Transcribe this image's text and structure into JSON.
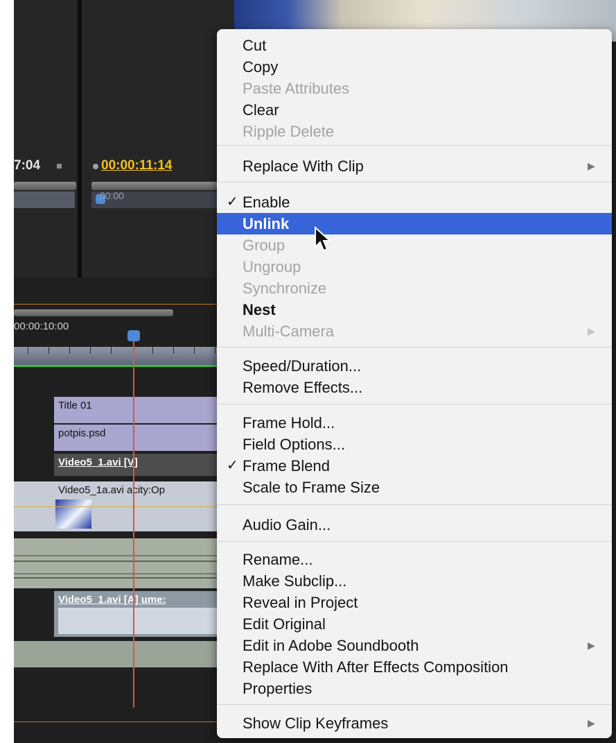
{
  "editor": {
    "timecode_left": "7:04",
    "timecode_current": "00:00:11:14",
    "mini_timecode": ":00:00",
    "ruler_timecode": "00:00:10:00",
    "clips": {
      "title": "Title 01",
      "graphic": "potpis.psd",
      "video": "Video5_1.avi [V]",
      "video_opacity": "Video5_1a.avi acity:Op",
      "audio": "Video5_1.avi [A] ume:"
    }
  },
  "menu": {
    "items": [
      {
        "label": "Cut"
      },
      {
        "label": "Copy"
      },
      {
        "label": "Paste Attributes"
      },
      {
        "label": "Clear"
      },
      {
        "label": "Ripple Delete"
      },
      {
        "label": "Replace With Clip"
      },
      {
        "label": "Enable",
        "check": "✓"
      },
      {
        "label": "Unlink"
      },
      {
        "label": "Group"
      },
      {
        "label": "Ungroup"
      },
      {
        "label": "Synchronize"
      },
      {
        "label": "Nest"
      },
      {
        "label": "Multi-Camera"
      },
      {
        "label": "Speed/Duration..."
      },
      {
        "label": "Remove Effects..."
      },
      {
        "label": "Frame Hold..."
      },
      {
        "label": "Field Options..."
      },
      {
        "label": "Frame Blend",
        "check": "✓"
      },
      {
        "label": "Scale to Frame Size"
      },
      {
        "label": "Audio Gain..."
      },
      {
        "label": "Rename..."
      },
      {
        "label": "Make Subclip..."
      },
      {
        "label": "Reveal in Project"
      },
      {
        "label": "Edit Original"
      },
      {
        "label": "Edit in Adobe Soundbooth"
      },
      {
        "label": "Replace With After Effects Composition"
      },
      {
        "label": "Properties"
      },
      {
        "label": "Show Clip Keyframes"
      }
    ],
    "submenu_arrow": "▶",
    "highlight_color": "#3764d8"
  }
}
